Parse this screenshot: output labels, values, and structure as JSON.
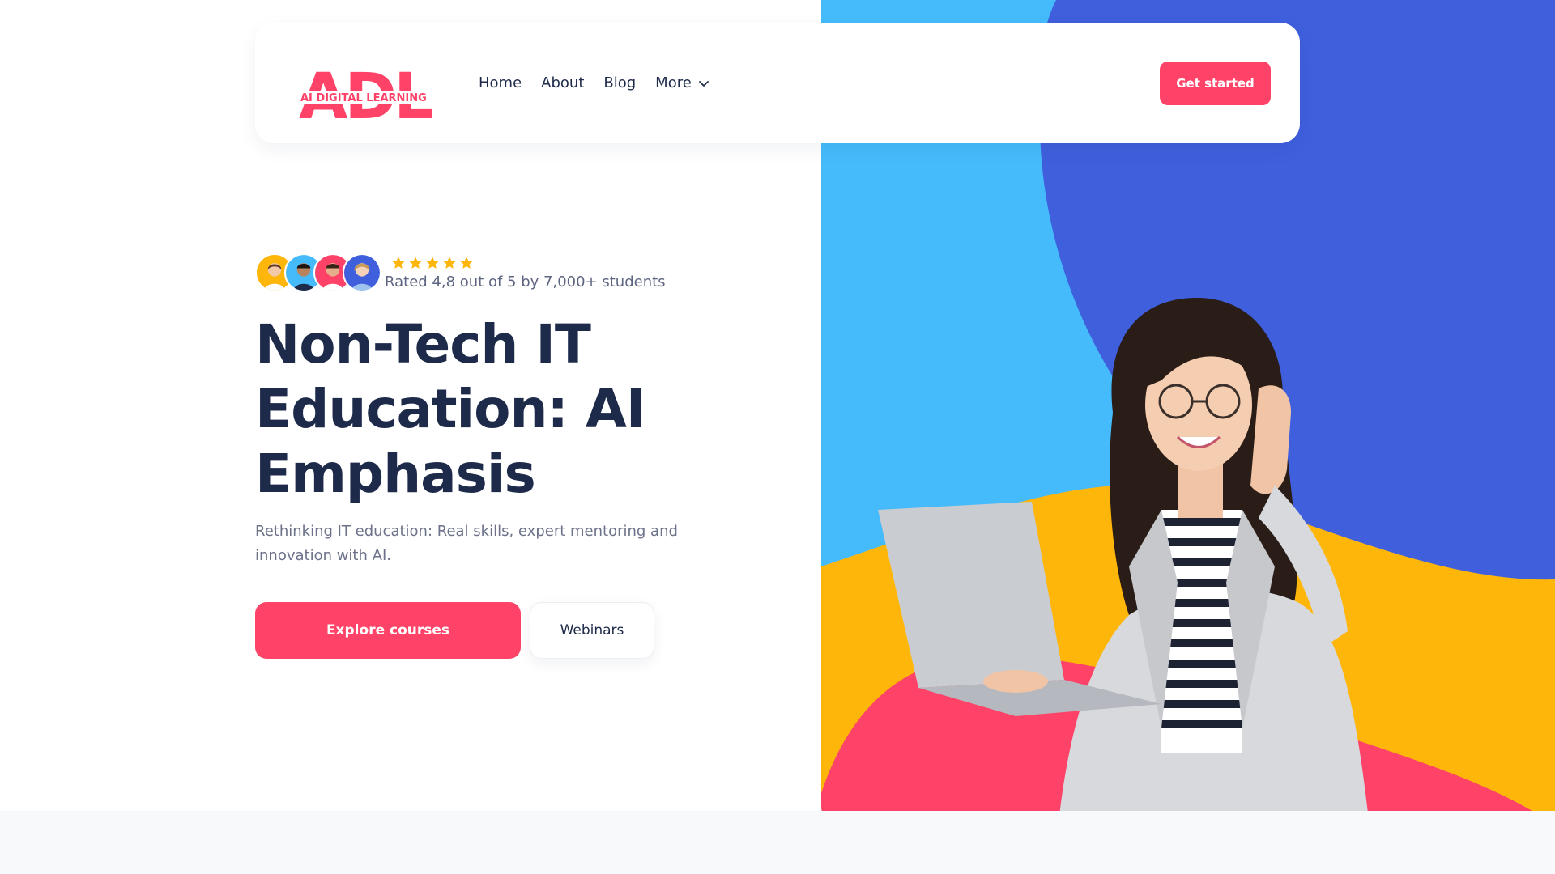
{
  "brand": {
    "logo_text": "ADL",
    "logo_subtitle": "AI DIGITAL LEARNING",
    "accent_color": "#ff4267",
    "navy_color": "#1e2a4a"
  },
  "nav": {
    "items": [
      {
        "label": "Home"
      },
      {
        "label": "About"
      },
      {
        "label": "Blog"
      },
      {
        "label": "More",
        "icon": "chevron-down-icon"
      }
    ],
    "cta_label": "Get started"
  },
  "hero": {
    "rating_stars": 5,
    "rating_text": "Rated 4,8 out of 5 by 7,000+ students",
    "headline_lines": [
      "Non-Tech IT",
      "Education: AI",
      "Emphasis"
    ],
    "subtext": "Rethinking IT education: Real skills, expert mentoring and innovation with AI.",
    "primary_cta": "Explore courses",
    "secondary_cta": "Webinars"
  },
  "colors": {
    "sky_blue": "#45bbfb",
    "royal_blue": "#3f5fdd",
    "yellow": "#ffb60a",
    "pink": "#ff4267",
    "star": "#ffb60a"
  }
}
